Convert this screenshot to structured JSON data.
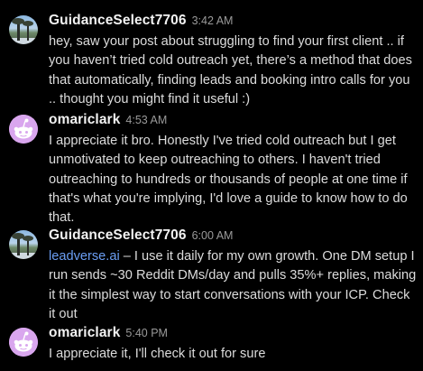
{
  "messages": [
    {
      "author": "GuidanceSelect7706",
      "time": "3:42 AM",
      "avatar": "palm-tree-photo-avatar",
      "text": "hey, saw your post about struggling to find your first client .. if you haven’t tried cold outreach yet, there’s a method that does that automatically, finding leads and booking intro calls for you .. thought you might find it useful :)"
    },
    {
      "author": "omariclark",
      "time": "4:53 AM",
      "avatar": "reddit-alien-avatar",
      "text": "I appreciate it bro. Honestly I've tried cold outreach but I get unmotivated to keep outreaching to others. I haven't tried outreaching to hundreds or thousands of people at one time if that's what you're implying, I'd love a guide to know how to do that."
    },
    {
      "author": "GuidanceSelect7706",
      "time": "6:00 AM",
      "avatar": "palm-tree-photo-avatar",
      "link": "leadverse.ai",
      "text": " – I use it daily for my own growth. One DM setup I run sends ~30 Reddit DMs/day and pulls 35%+ replies, making it the simplest way to start conversations with your ICP. Check it out"
    },
    {
      "author": "omariclark",
      "time": "5:40 PM",
      "avatar": "reddit-alien-avatar",
      "text": "I appreciate it, I'll check it out for sure"
    }
  ],
  "colors": {
    "background": "#000000",
    "username": "#f2f2f2",
    "timestamp": "#9a9a9a",
    "text": "#dcdcdc",
    "link": "#6b9ef3",
    "alien_avatar_bg": "#d9a6ee"
  }
}
